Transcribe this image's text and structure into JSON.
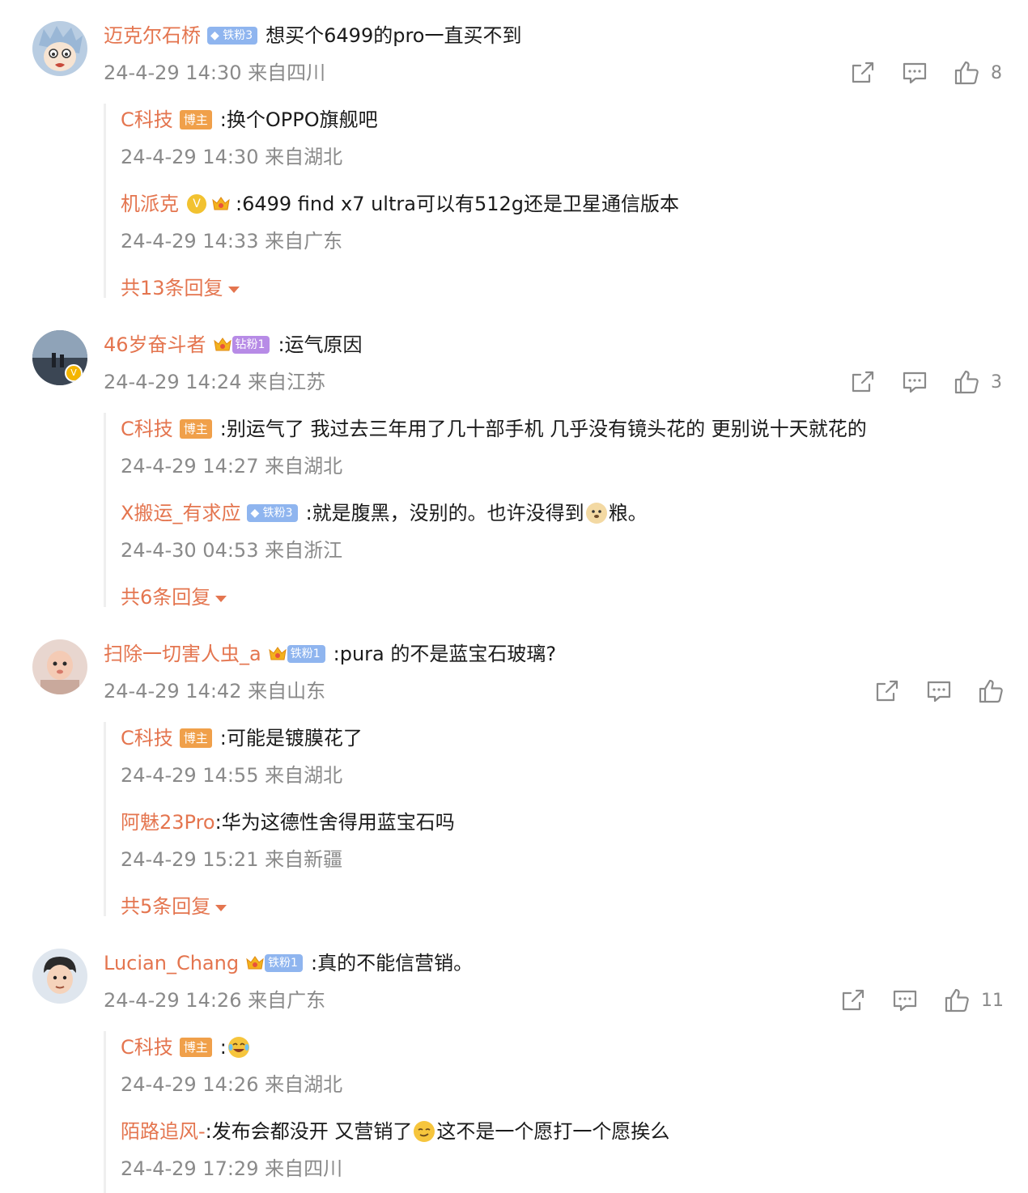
{
  "colors": {
    "username": "#e4754f",
    "meta": "#8a8a8a",
    "host_badge": "#f0a04a",
    "fan_badge": "#8fb5ef",
    "diamond_badge": "#b78be6"
  },
  "comments": [
    {
      "user": "迈克尔石桥",
      "badge": "铁粉3",
      "text": "想买个6499的pro一直买不到",
      "meta": "24-4-29 14:30 来自四川",
      "likes": "8",
      "replies": [
        {
          "user": "C科技",
          "badge": "博主",
          "text": ":换个OPPO旗舰吧",
          "meta": "24-4-29 14:30 来自湖北"
        },
        {
          "user": "机派克",
          "text": ":6499 find x7 ultra可以有512g还是卫星通信版本",
          "meta": "24-4-29 14:33 来自广东"
        }
      ],
      "more": "共13条回复"
    },
    {
      "user": "46岁奋斗者",
      "badge": "钻粉1",
      "text": ":运气原因",
      "meta": "24-4-29 14:24 来自江苏",
      "likes": "3",
      "replies": [
        {
          "user": "C科技",
          "badge": "博主",
          "text": ":别运气了 我过去三年用了几十部手机 几乎没有镜头花的 更别说十天就花的",
          "meta": "24-4-29 14:27 来自湖北"
        },
        {
          "user": "X搬运_有求应",
          "badge": "铁粉3",
          "text_a": ":就是腹黑，没别的。也许没得到",
          "text_b": "粮。",
          "meta": "24-4-30 04:53 来自浙江"
        }
      ],
      "more": "共6条回复"
    },
    {
      "user": "扫除一切害人虫_a",
      "badge": "铁粉1",
      "text": ":pura 的不是蓝宝石玻璃?",
      "meta": "24-4-29 14:42 来自山东",
      "likes": "",
      "replies": [
        {
          "user": "C科技",
          "badge": "博主",
          "text": ":可能是镀膜花了",
          "meta": "24-4-29 14:55 来自湖北"
        },
        {
          "user": "阿魅23Pro",
          "text": ":华为这德性舍得用蓝宝石吗",
          "meta": "24-4-29 15:21 来自新疆"
        }
      ],
      "more": "共5条回复"
    },
    {
      "user": "Lucian_Chang",
      "badge": "铁粉1",
      "text": ":真的不能信营销。",
      "meta": "24-4-29 14:26 来自广东",
      "likes": "11",
      "replies": [
        {
          "user": "C科技",
          "badge": "博主",
          "text": ":",
          "meta": "24-4-29 14:26 来自湖北"
        },
        {
          "user": "陌路追风-",
          "text_a": ":发布会都没开 又营销了",
          "text_b": "这不是一个愿打一个愿挨么",
          "meta": "24-4-29 17:29 来自四川"
        }
      ]
    }
  ]
}
